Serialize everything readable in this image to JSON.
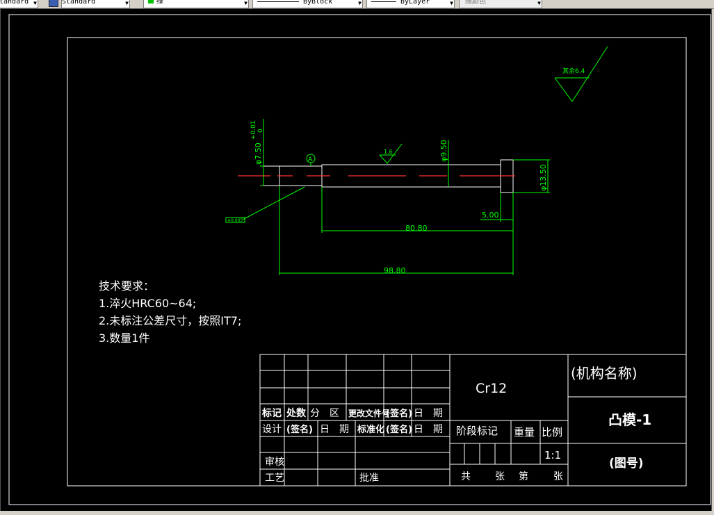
{
  "toolbar": {
    "text_style": "tandard",
    "dim_style": "Standard",
    "layer": "绿",
    "linetype": "ByBlock",
    "lineweight": "ByLayer",
    "plot_style": "随颜色",
    "layer_color": "#00c000"
  },
  "drawing": {
    "roughness_corner": "其余6.4",
    "roughness_local": "1.6",
    "datum_label": "A",
    "dim_left_dia": "φ7.50",
    "dim_left_tol_upper": "+0.01",
    "dim_left_tol_lower": "0",
    "dim_mid_dia": "φ9.50",
    "dim_head_dia": "φ13.50",
    "dim_head_len": "5.00",
    "dim_body_len": "80.80",
    "dim_total_len": "98.80",
    "tolerance_frame": "≠0.005"
  },
  "requirements": {
    "title": "技术要求：",
    "lines": [
      "1.淬火HRC60~64;",
      "2.未标注公差尺寸，按照IT7;",
      "3.数量1件"
    ]
  },
  "title_block": {
    "material": "Cr12",
    "mechanism_name": "(机构名称)",
    "part_name": "凸模-1",
    "drawing_no": "(图号)",
    "row_mark": [
      "标记",
      "处数",
      "分　区",
      "更改文件号",
      "(签名)",
      "日　期"
    ],
    "row_design": [
      "设计",
      "(签名)",
      "日　期",
      "标准化",
      "(签名)",
      "日　期"
    ],
    "review": "审核",
    "process": "工艺",
    "approve": "批准",
    "stage_mark": "阶段标记",
    "weight": "重量",
    "scale": "比例",
    "scale_value": "1:1",
    "sheets": [
      "共",
      "张",
      "第",
      "张"
    ]
  },
  "colors": {
    "canvas": "#000000",
    "outline": "#ffffff",
    "dimension": "#00ff00",
    "centerline": "#ff0000"
  }
}
